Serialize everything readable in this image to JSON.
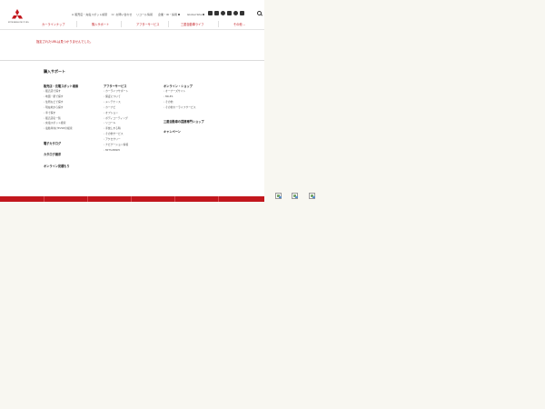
{
  "header": {
    "logo_text": "MITSUBISHI MOTORS",
    "utility_links": [
      {
        "icon": "store-icon",
        "label": "販売店・充電スポット検索"
      },
      {
        "icon": "phone-icon",
        "label": "お問い合わせ"
      },
      {
        "icon": "",
        "label": "リコール情報"
      },
      {
        "icon": "",
        "label": "企業・IR・採用"
      },
      {
        "icon": "",
        "label": "Global Site"
      }
    ],
    "nav": [
      {
        "label": "カーラインナップ",
        "chevron": ""
      },
      {
        "label": "購入サポート",
        "chevron": ""
      },
      {
        "label": "アフターサービス",
        "chevron": ""
      },
      {
        "label": "三菱自動車ライフ",
        "chevron": ""
      },
      {
        "label": "その他",
        "chevron": "⌄"
      }
    ],
    "social_icons": [
      "facebook-icon",
      "twitter-icon",
      "line-icon",
      "youtube-icon",
      "instagram-icon",
      "mail-icon"
    ]
  },
  "message": "指定されたURLは見つかりませんでした。",
  "footer": {
    "title": "購入サポート",
    "col1": {
      "head": "販売店・充電スポット検索",
      "items": [
        "販売店で探す",
        "地図・駅で探す",
        "住所などで探す",
        "現在地から探す",
        "車で探す",
        "販売店名一覧",
        "充電スポット検索",
        "電動車向けEVSEの検索"
      ]
    },
    "col1_extra": [
      "電子カタログ",
      "カタログ請求",
      "オンライン見積もり"
    ],
    "col2": {
      "head": "アフターサービス",
      "items": [
        "カーライフサポート",
        "保証について",
        "メンテナンス",
        "カーナビ",
        "オプション",
        "ボディコーティング",
        "リコール",
        "手放しする時",
        "その他サービス",
        "アクセサリー",
        "ナビゲーション情報",
        "MITSUBISHI"
      ]
    },
    "col3": {
      "head": "オンライン・ショップ",
      "items": [
        "オーナーズサイト",
        "MILES",
        "その他",
        "その他カーライフサービス"
      ]
    },
    "col3_extra": [
      "三菱自動車の提携専門ショップ",
      "キャンペーン"
    ]
  },
  "colors": {
    "brand_red": "#c2171d",
    "background": "#f8f7f1"
  }
}
